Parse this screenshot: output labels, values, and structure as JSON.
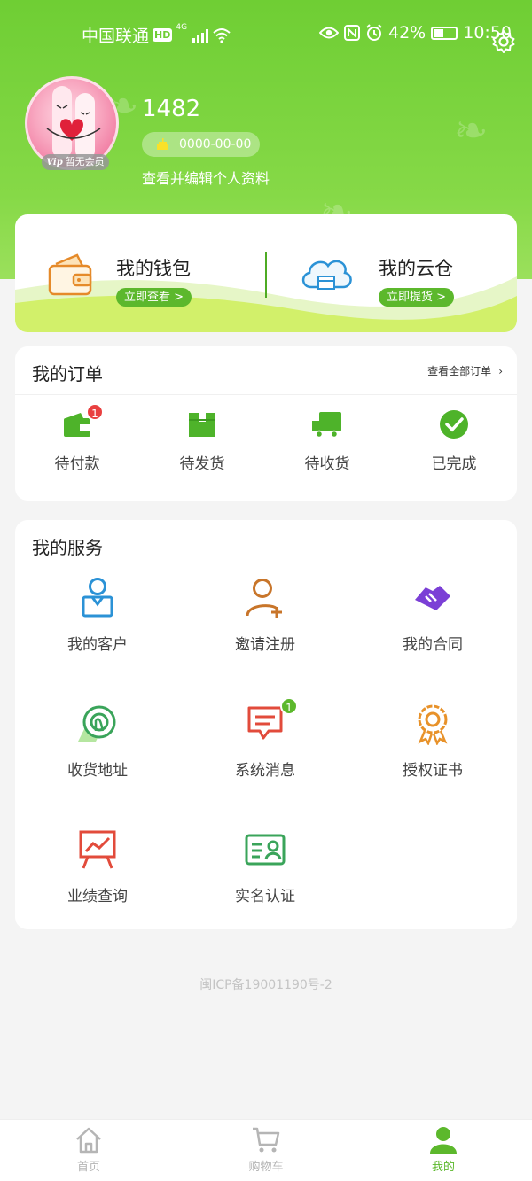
{
  "status_bar": {
    "carrier": "中国联通",
    "hd": "HD",
    "network": "4G",
    "battery": "42%",
    "time": "10:50"
  },
  "profile": {
    "user_id": "1482",
    "vip_label": "暂无会员",
    "vip_mark": "Vip",
    "date": "0000-00-00",
    "edit_link": "查看并编辑个人资料"
  },
  "wallet": {
    "title": "我的钱包",
    "button": "立即查看 >"
  },
  "cloud": {
    "title": "我的云仓",
    "button": "立即提货 >"
  },
  "orders": {
    "title": "我的订单",
    "view_all": "查看全部订单",
    "items": [
      {
        "label": "待付款",
        "icon": "wallet-icon",
        "badge": "1"
      },
      {
        "label": "待发货",
        "icon": "box-icon"
      },
      {
        "label": "待收货",
        "icon": "truck-icon"
      },
      {
        "label": "已完成",
        "icon": "check-circle-icon"
      }
    ]
  },
  "services": {
    "title": "我的服务",
    "items": [
      {
        "label": "我的客户",
        "icon": "customer-icon"
      },
      {
        "label": "邀请注册",
        "icon": "add-user-icon"
      },
      {
        "label": "我的合同",
        "icon": "handshake-icon"
      },
      {
        "label": "收货地址",
        "icon": "location-icon"
      },
      {
        "label": "系统消息",
        "icon": "message-icon",
        "badge": "1"
      },
      {
        "label": "授权证书",
        "icon": "certificate-icon"
      },
      {
        "label": "业绩查询",
        "icon": "chart-board-icon"
      },
      {
        "label": "实名认证",
        "icon": "id-card-icon"
      }
    ]
  },
  "icp": "闽ICP备19001190号-2",
  "tabbar": [
    {
      "label": "首页",
      "icon": "home-icon"
    },
    {
      "label": "购物车",
      "icon": "cart-icon"
    },
    {
      "label": "我的",
      "icon": "user-icon",
      "active": true
    }
  ],
  "colors": {
    "brand_green": "#6fce34",
    "button_green": "#5cb82c",
    "badge_red": "#e94040"
  }
}
